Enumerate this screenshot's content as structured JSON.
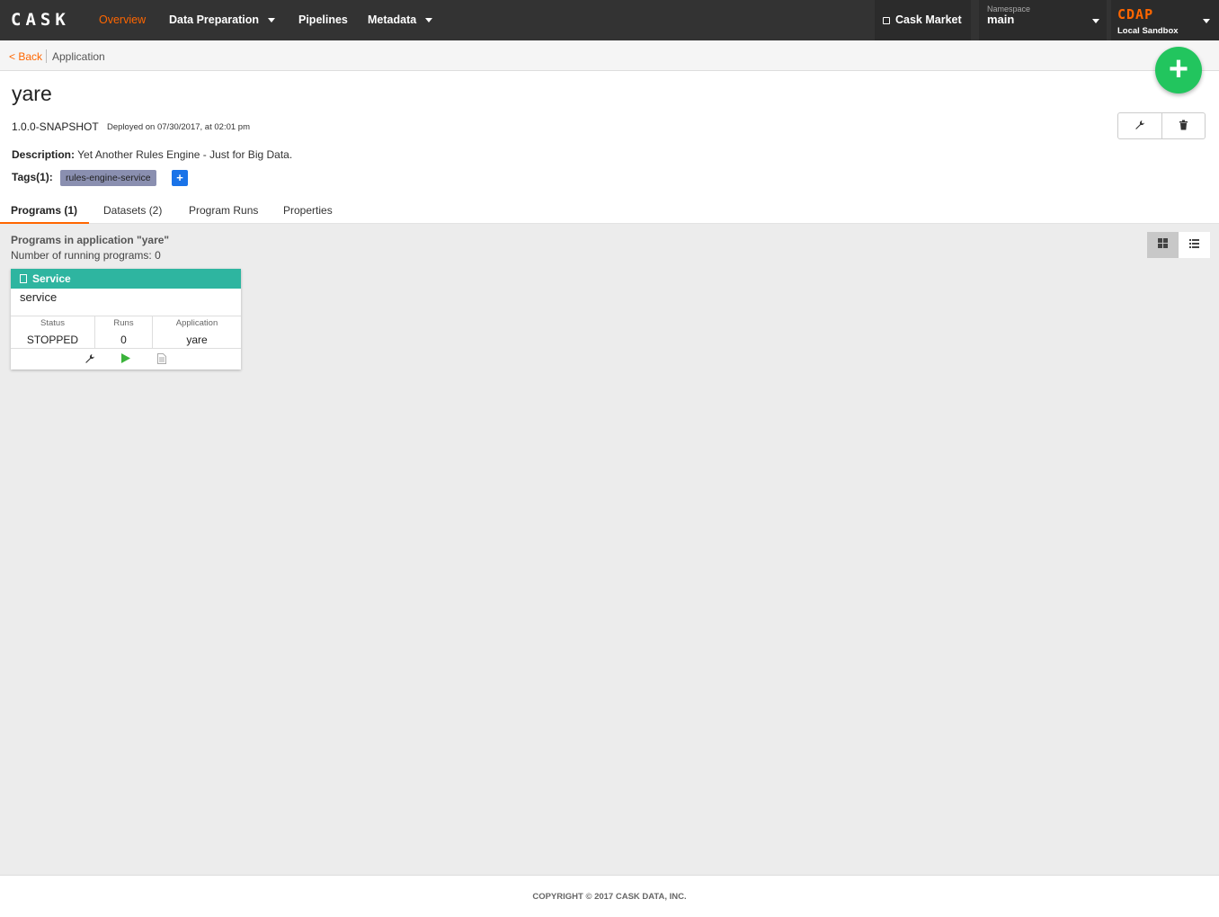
{
  "nav": {
    "brand": "CASK",
    "items": [
      "Overview",
      "Data Preparation",
      "Pipelines",
      "Metadata"
    ],
    "market": "Cask Market",
    "namespace_label": "Namespace",
    "namespace_value": "main",
    "cdap_logo": "CDAP",
    "cdap_sub": "Local Sandbox"
  },
  "breadcrumb": {
    "back": "< Back",
    "current": "Application"
  },
  "app": {
    "name": "yare",
    "version": "1.0.0-SNAPSHOT",
    "deployed": "Deployed on 07/30/2017, at 02:01 pm",
    "description_label": "Description:",
    "description": "Yet Another Rules Engine - Just for Big Data.",
    "tags_label": "Tags(1):",
    "tag": "rules-engine-service",
    "add_tag": "+",
    "fab": "+"
  },
  "tabs": [
    "Programs (1)",
    "Datasets (2)",
    "Program Runs",
    "Properties"
  ],
  "programs": {
    "title": "Programs in application \"yare\"",
    "running": "Number of running programs: 0",
    "card": {
      "type": "Service",
      "name": "service",
      "status_label": "Status",
      "status": "STOPPED",
      "runs_label": "Runs",
      "runs": "0",
      "app_label": "Application",
      "app": "yare"
    }
  },
  "icons": {
    "wrench": "wrench-icon",
    "trash": "trash-icon",
    "grid": "grid-view-icon",
    "list": "list-view-icon",
    "play": "play-icon",
    "logs": "logs-icon"
  },
  "colors": {
    "accent": "#ff6600",
    "service": "#2eb5a0",
    "fab": "#22c55e",
    "tag": "#8a8fb0"
  },
  "footer": "COPYRIGHT © 2017 CASK DATA, INC."
}
